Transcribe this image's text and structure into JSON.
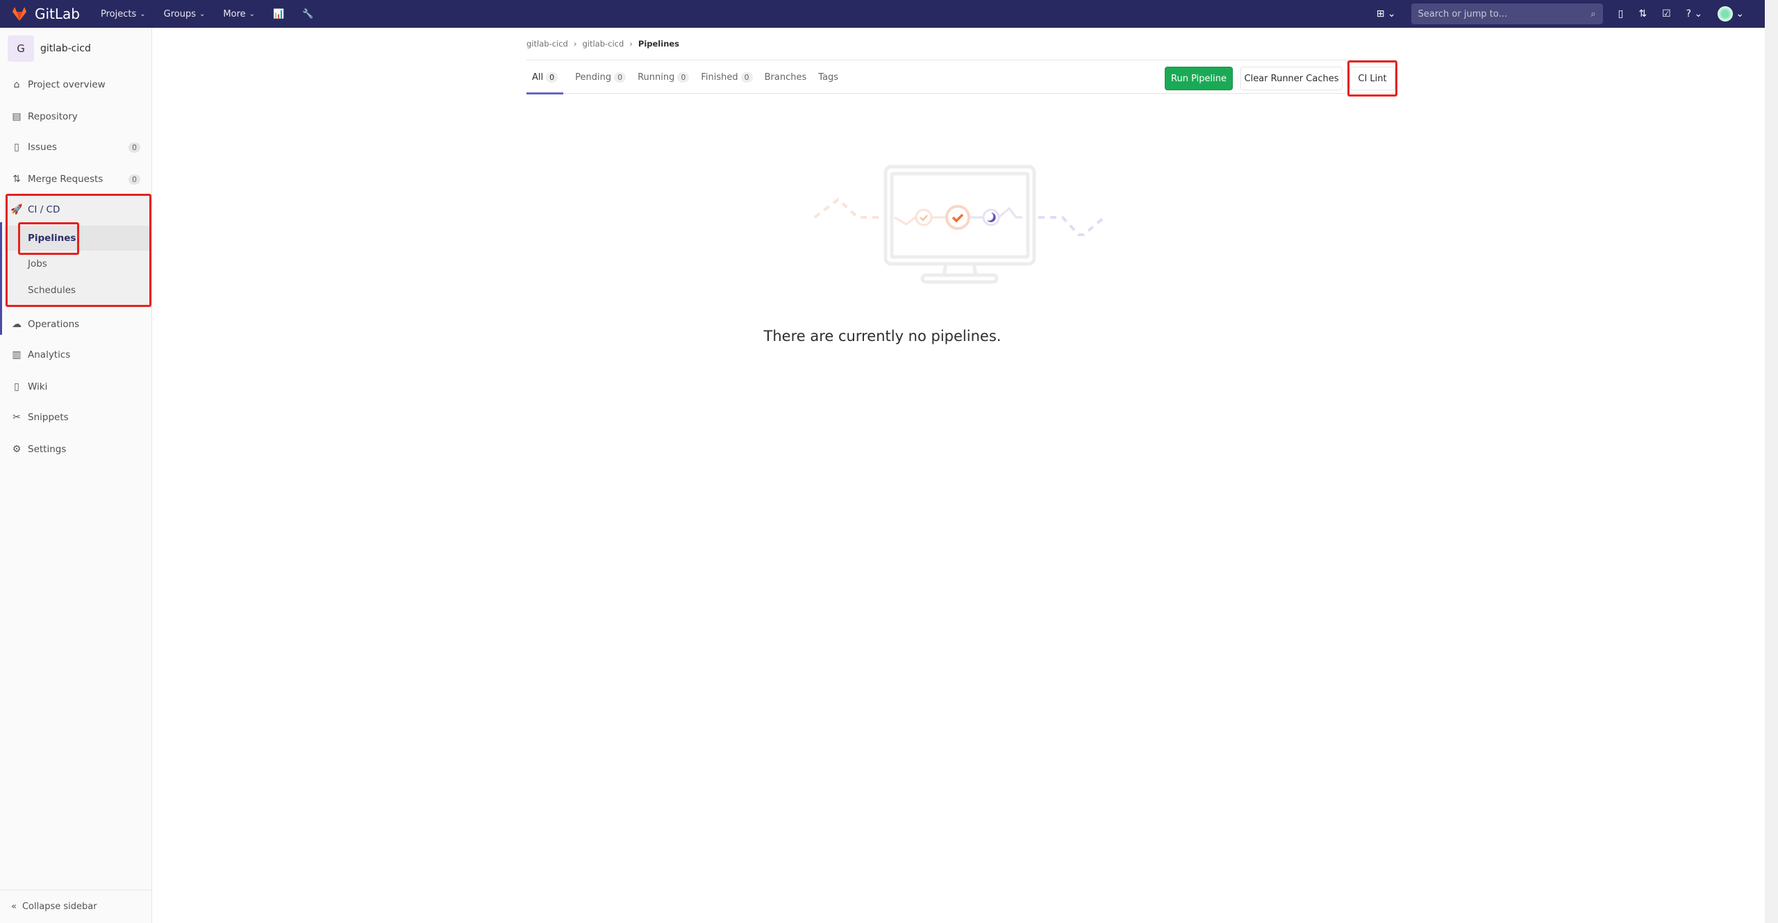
{
  "topbar": {
    "brand": "GitLab",
    "nav": [
      "Projects",
      "Groups",
      "More"
    ],
    "search_placeholder": "Search or jump to..."
  },
  "sidebar": {
    "project_initial": "G",
    "project_name": "gitlab-cicd",
    "items": [
      {
        "label": "Project overview",
        "icon": "home-icon"
      },
      {
        "label": "Repository",
        "icon": "doc-icon"
      },
      {
        "label": "Issues",
        "icon": "issues-icon",
        "count": "0"
      },
      {
        "label": "Merge Requests",
        "icon": "merge-request-icon",
        "count": "0"
      },
      {
        "label": "CI / CD",
        "icon": "rocket-icon"
      }
    ],
    "ci_sub": [
      "Pipelines",
      "Jobs",
      "Schedules"
    ],
    "items2": [
      {
        "label": "Operations",
        "icon": "cloud-gear-icon"
      },
      {
        "label": "Analytics",
        "icon": "chart-icon"
      },
      {
        "label": "Wiki",
        "icon": "book-icon"
      },
      {
        "label": "Snippets",
        "icon": "scissors-icon"
      },
      {
        "label": "Settings",
        "icon": "gear-icon"
      }
    ],
    "collapse": "Collapse sidebar"
  },
  "breadcrumb": [
    "gitlab-cicd",
    "gitlab-cicd",
    "Pipelines"
  ],
  "tabs": [
    {
      "label": "All",
      "count": "0"
    },
    {
      "label": "Pending",
      "count": "0"
    },
    {
      "label": "Running",
      "count": "0"
    },
    {
      "label": "Finished",
      "count": "0"
    },
    {
      "label": "Branches"
    },
    {
      "label": "Tags"
    }
  ],
  "buttons": {
    "run": "Run Pipeline",
    "clear": "Clear Runner Caches",
    "lint": "CI Lint"
  },
  "empty_message": "There are currently no pipelines.",
  "colors": {
    "topbar": "#292961",
    "run_button": "#1aaa55",
    "highlight": "#e5211f",
    "accent": "#6666c4"
  }
}
